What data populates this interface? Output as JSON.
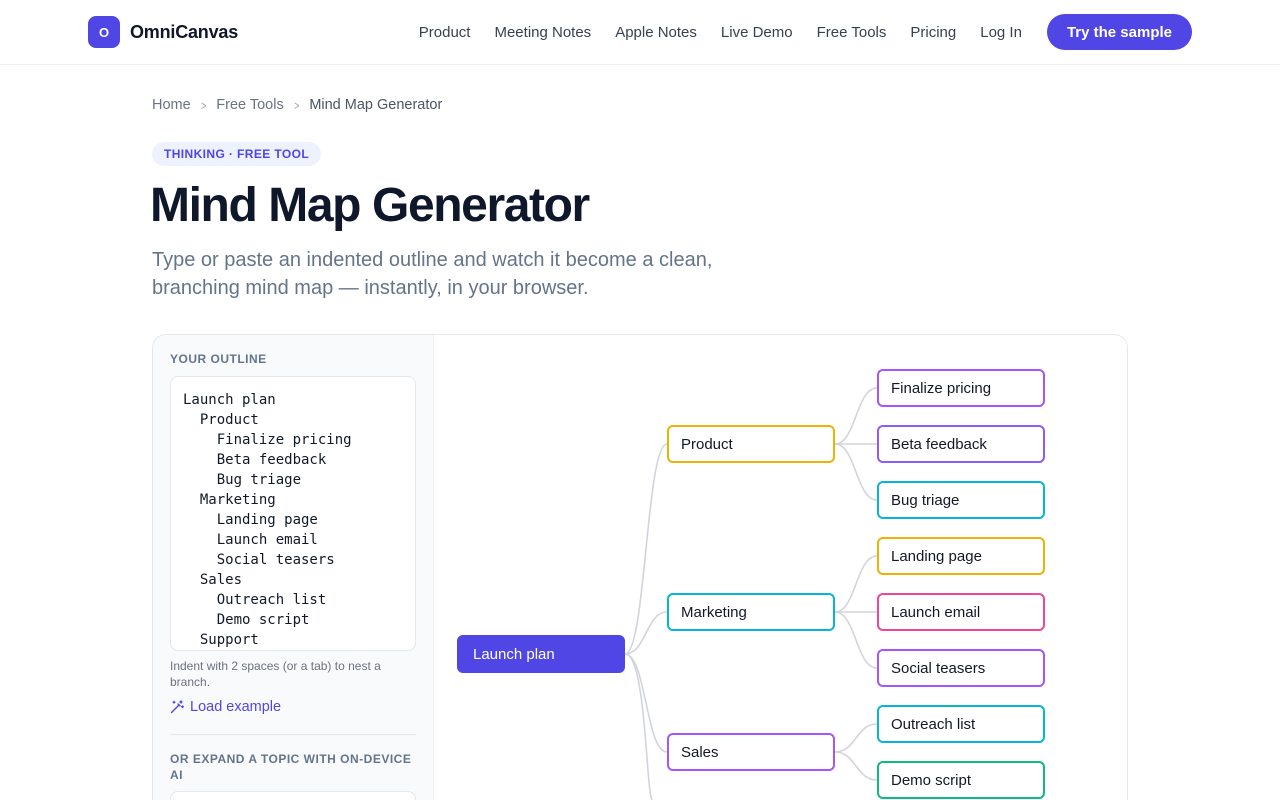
{
  "header": {
    "logo_letter": "O",
    "brand": "OmniCanvas",
    "nav": [
      "Product",
      "Meeting Notes",
      "Apple Notes",
      "Live Demo",
      "Free Tools",
      "Pricing",
      "Log In"
    ],
    "cta": "Try the sample",
    "accent": "#4f46e5"
  },
  "breadcrumb": [
    "Home",
    "Free Tools",
    "Mind Map Generator"
  ],
  "badge": "THINKING · FREE TOOL",
  "title": "Mind Map Generator",
  "subtitle": "Type or paste an indented outline and watch it become a clean, branching mind map — instantly, in your browser.",
  "panel": {
    "outline_label": "YOUR OUTLINE",
    "outline_lines": [
      "Launch plan",
      "  Product",
      "    Finalize pricing",
      "    Beta feedback",
      "    Bug triage",
      "  Marketing",
      "    Landing page",
      "    Launch email",
      "    Social teasers",
      "  Sales",
      "    Outreach list",
      "    Demo script",
      "  Support"
    ],
    "hint": "Indent with 2 spaces (or a tab) to nest a branch.",
    "load_example": "Load example",
    "ai_label": "OR EXPAND A TOPIC WITH ON-DEVICE AI"
  },
  "mindmap": {
    "root": "Launch plan",
    "branches": [
      {
        "label": "Product",
        "color": "#eab308",
        "children": [
          {
            "label": "Finalize pricing",
            "color": "#a855f7"
          },
          {
            "label": "Beta feedback",
            "color": "#8b5cf6"
          },
          {
            "label": "Bug triage",
            "color": "#06b6d4"
          }
        ]
      },
      {
        "label": "Marketing",
        "color": "#06b6d4",
        "children": [
          {
            "label": "Landing page",
            "color": "#eab308"
          },
          {
            "label": "Launch email",
            "color": "#ec4899"
          },
          {
            "label": "Social teasers",
            "color": "#a855f7"
          }
        ]
      },
      {
        "label": "Sales",
        "color": "#a855f7",
        "children": [
          {
            "label": "Outreach list",
            "color": "#06b6d4"
          },
          {
            "label": "Demo script",
            "color": "#10b981"
          }
        ]
      }
    ]
  }
}
